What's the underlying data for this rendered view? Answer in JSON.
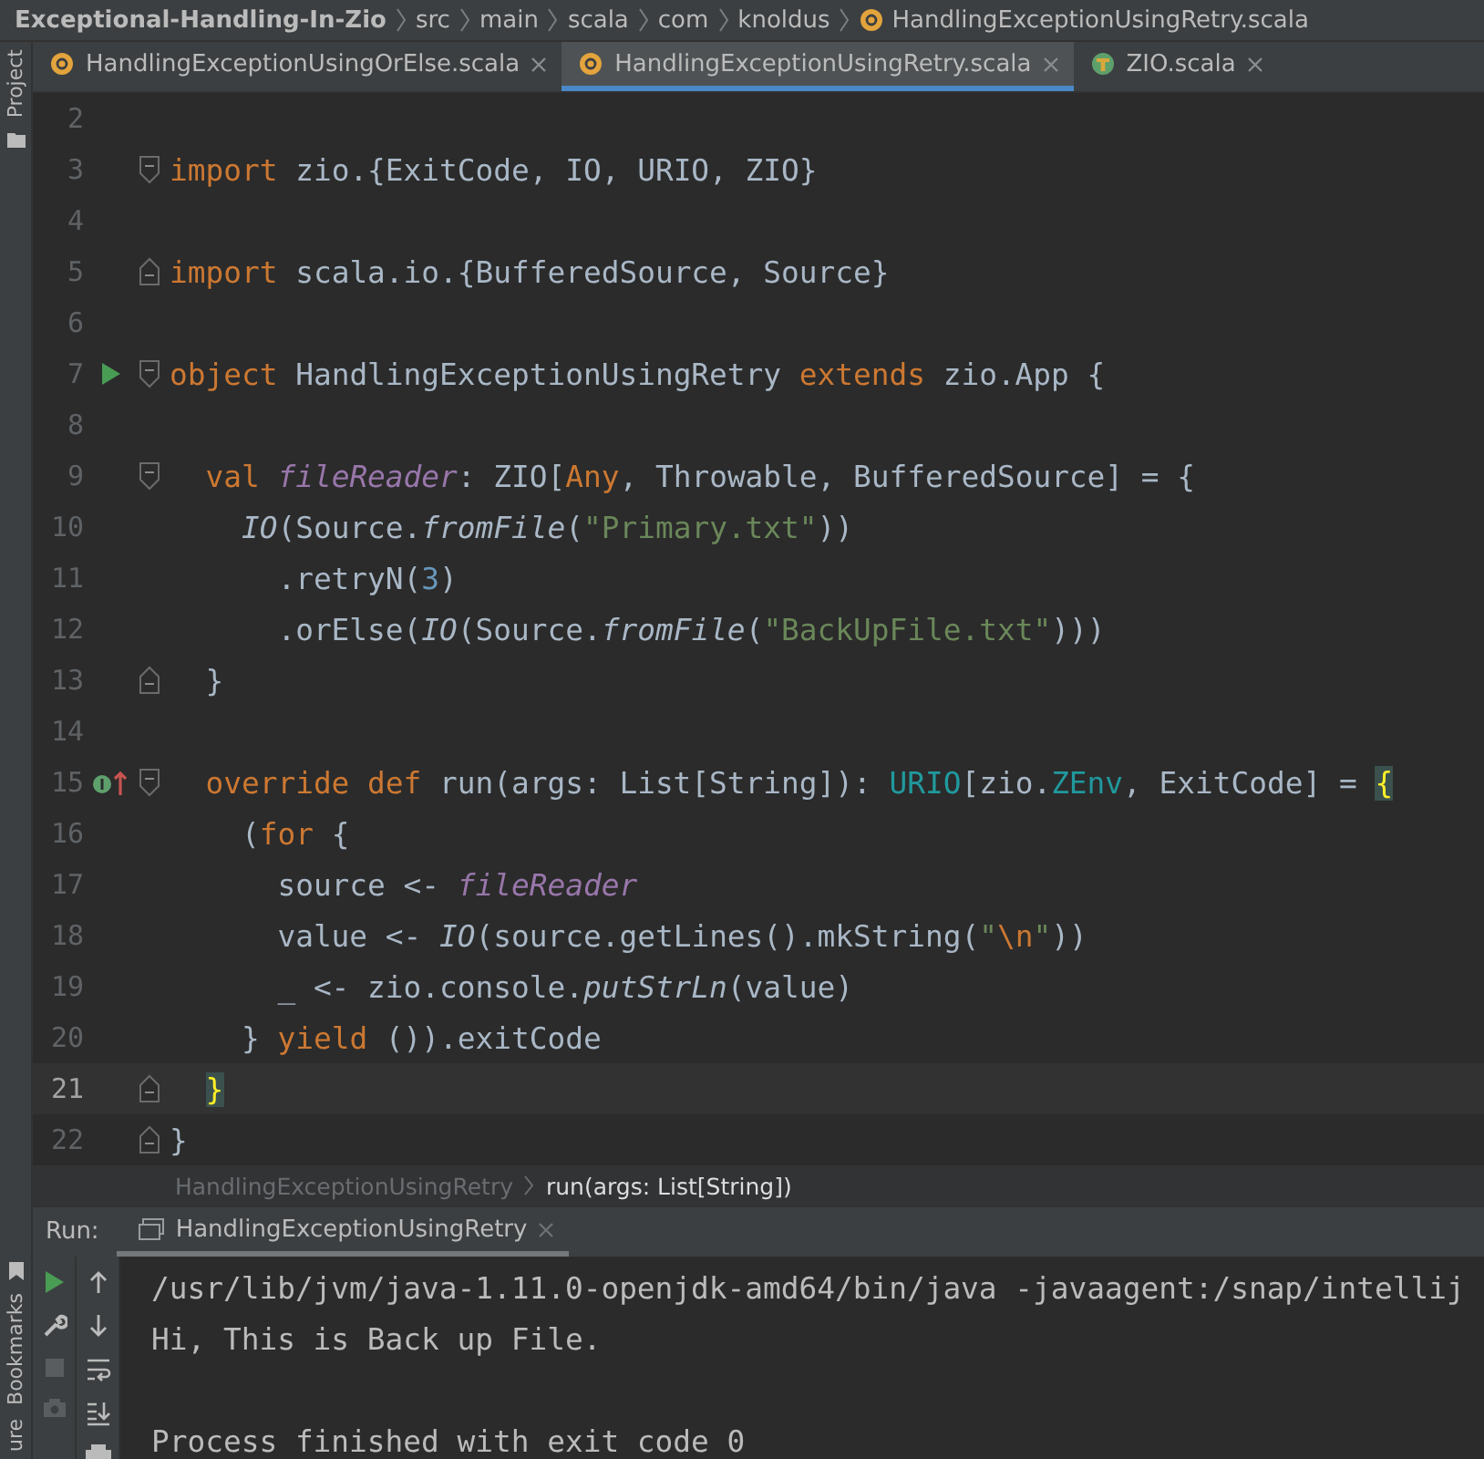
{
  "breadcrumbs": [
    {
      "label": "Exceptional-Handling-In-Zio",
      "kind": "project"
    },
    {
      "label": "src",
      "kind": "folder"
    },
    {
      "label": "main",
      "kind": "folder"
    },
    {
      "label": "scala",
      "kind": "folder"
    },
    {
      "label": "com",
      "kind": "folder"
    },
    {
      "label": "knoldus",
      "kind": "folder"
    },
    {
      "label": "HandlingExceptionUsingRetry.scala",
      "kind": "object"
    }
  ],
  "side_tools": [
    {
      "label": "Project",
      "kind": "top"
    },
    {
      "label": "Bookmarks",
      "kind": "bottom"
    },
    {
      "label": "ure",
      "kind": "bottom"
    }
  ],
  "tabs": [
    {
      "label": "HandlingExceptionUsingOrElse.scala",
      "kind": "object",
      "selected": false
    },
    {
      "label": "HandlingExceptionUsingRetry.scala",
      "kind": "object",
      "selected": true
    },
    {
      "label": "ZIO.scala",
      "kind": "trait",
      "selected": false
    }
  ],
  "lines": [
    {
      "number": "2",
      "current": false
    },
    {
      "number": "3",
      "current": false,
      "fold_start": true,
      "tokens": [
        {
          "text": "import",
          "kind": "kw"
        },
        {
          "text": " zio.{ExitCode, IO, URIO, ZIO}",
          "kind": "plain"
        }
      ]
    },
    {
      "number": "4",
      "current": false
    },
    {
      "number": "5",
      "current": false,
      "fold_end": true,
      "tokens": [
        {
          "text": "import",
          "kind": "kw"
        },
        {
          "text": " scala.io.{BufferedSource, Source}",
          "kind": "plain"
        }
      ]
    },
    {
      "number": "6",
      "current": false
    },
    {
      "number": "7",
      "current": false,
      "fold_start": true,
      "run_marker": true,
      "tokens": [
        {
          "text": "object",
          "kind": "kw"
        },
        {
          "text": " HandlingExceptionUsingRetry ",
          "kind": "plain"
        },
        {
          "text": "extends",
          "kind": "kw"
        },
        {
          "text": " zio.App {",
          "kind": "plain"
        }
      ]
    },
    {
      "number": "8",
      "current": false
    },
    {
      "number": "9",
      "current": false,
      "fold_start": true,
      "tokens": [
        {
          "text": "  val ",
          "kind": "kw"
        },
        {
          "text": "fileReader",
          "kind": "member"
        },
        {
          "text": ": ZIO[",
          "kind": "plain"
        },
        {
          "text": "Any",
          "kind": "kw"
        },
        {
          "text": ", Throwable, BufferedSource] = {",
          "kind": "plain"
        }
      ]
    },
    {
      "number": "10",
      "current": false,
      "tokens": [
        {
          "text": "    IO",
          "kind": "italic"
        },
        {
          "text": "(Source.",
          "kind": "plain"
        },
        {
          "text": "fromFile",
          "kind": "italic"
        },
        {
          "text": "(",
          "kind": "plain"
        },
        {
          "text": "\"Primary.txt\"",
          "kind": "str"
        },
        {
          "text": "))",
          "kind": "plain"
        }
      ]
    },
    {
      "number": "11",
      "current": false,
      "tokens": [
        {
          "text": "      .retryN(",
          "kind": "plain"
        },
        {
          "text": "3",
          "kind": "num"
        },
        {
          "text": ")",
          "kind": "plain"
        }
      ]
    },
    {
      "number": "12",
      "current": false,
      "tokens": [
        {
          "text": "      .orElse(",
          "kind": "plain"
        },
        {
          "text": "IO",
          "kind": "italic"
        },
        {
          "text": "(Source.",
          "kind": "plain"
        },
        {
          "text": "fromFile",
          "kind": "italic"
        },
        {
          "text": "(",
          "kind": "plain"
        },
        {
          "text": "\"BackUpFile.txt\"",
          "kind": "str"
        },
        {
          "text": ")))",
          "kind": "plain"
        }
      ]
    },
    {
      "number": "13",
      "current": false,
      "fold_end": true,
      "tokens": [
        {
          "text": "  }",
          "kind": "plain"
        }
      ]
    },
    {
      "number": "14",
      "current": false
    },
    {
      "number": "15",
      "current": false,
      "fold_start": true,
      "override_marker": true,
      "tokens": [
        {
          "text": "  override def",
          "kind": "kw"
        },
        {
          "text": " run(args: List[String]): ",
          "kind": "plain"
        },
        {
          "text": "URIO",
          "kind": "teal"
        },
        {
          "text": "[zio.",
          "kind": "plain"
        },
        {
          "text": "ZEnv",
          "kind": "teal"
        },
        {
          "text": ", ExitCode] = ",
          "kind": "plain"
        },
        {
          "text": "{",
          "kind": "brace"
        }
      ]
    },
    {
      "number": "16",
      "current": false,
      "tokens": [
        {
          "text": "    (",
          "kind": "plain"
        },
        {
          "text": "for",
          "kind": "kw"
        },
        {
          "text": " {",
          "kind": "plain"
        }
      ]
    },
    {
      "number": "17",
      "current": false,
      "tokens": [
        {
          "text": "      source <- ",
          "kind": "plain"
        },
        {
          "text": "fileReader",
          "kind": "member"
        }
      ]
    },
    {
      "number": "18",
      "current": false,
      "tokens": [
        {
          "text": "      value <- ",
          "kind": "plain"
        },
        {
          "text": "IO",
          "kind": "italic"
        },
        {
          "text": "(source.getLines().mkString(",
          "kind": "plain"
        },
        {
          "text": "\"",
          "kind": "str"
        },
        {
          "text": "\\n",
          "kind": "kw"
        },
        {
          "text": "\"",
          "kind": "str"
        },
        {
          "text": "))",
          "kind": "plain"
        }
      ]
    },
    {
      "number": "19",
      "current": false,
      "tokens": [
        {
          "text": "      _ <- zio.console.",
          "kind": "plain"
        },
        {
          "text": "putStrLn",
          "kind": "italic"
        },
        {
          "text": "(value)",
          "kind": "plain"
        }
      ]
    },
    {
      "number": "20",
      "current": false,
      "tokens": [
        {
          "text": "    } ",
          "kind": "plain"
        },
        {
          "text": "yield",
          "kind": "kw"
        },
        {
          "text": " ()).exitCode",
          "kind": "plain"
        }
      ]
    },
    {
      "number": "21",
      "current": true,
      "fold_end": true,
      "tokens": [
        {
          "text": "  }",
          "kind": "brace"
        }
      ]
    },
    {
      "number": "22",
      "current": false,
      "fold_end": true,
      "tokens": [
        {
          "text": "}",
          "kind": "plain"
        }
      ]
    }
  ],
  "editor_breadcrumbs": [
    {
      "label": "HandlingExceptionUsingRetry",
      "selected": false
    },
    {
      "label": "run(args: List[String])",
      "selected": true
    }
  ],
  "run_panel": {
    "label": "Run:",
    "tab": "HandlingExceptionUsingRetry",
    "console": [
      {
        "text": "/usr/lib/jvm/java-1.11.0-openjdk-amd64/bin/java -javaagent:/snap/intellij",
        "kind": "command"
      },
      {
        "text": "Hi, This is Back up File.",
        "kind": "output"
      },
      {
        "text": "Process finished with exit code 0",
        "kind": "exit"
      }
    ]
  }
}
